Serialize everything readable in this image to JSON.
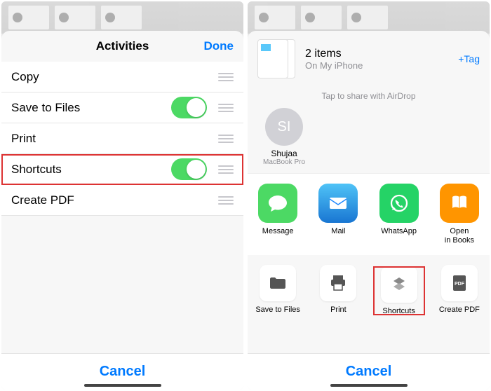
{
  "left": {
    "title": "Activities",
    "done": "Done",
    "rows": [
      {
        "label": "Copy",
        "toggle": false
      },
      {
        "label": "Save to Files",
        "toggle": true
      },
      {
        "label": "Print",
        "toggle": false
      },
      {
        "label": "Shortcuts",
        "toggle": true,
        "highlight": true
      },
      {
        "label": "Create PDF",
        "toggle": false
      }
    ],
    "cancel": "Cancel"
  },
  "right": {
    "items_title": "2 items",
    "items_sub": "On My iPhone",
    "tag": "+Tag",
    "airdrop_hint": "Tap to share with AirDrop",
    "contact": {
      "initials": "SI",
      "name": "Shujaa",
      "device": "MacBook Pro"
    },
    "apps": [
      {
        "name": "Message",
        "color": "#4cd964"
      },
      {
        "name": "Mail",
        "color": "#1e88ff"
      },
      {
        "name": "WhatsApp",
        "color": "#25d366"
      },
      {
        "name": "Open\nin Books",
        "color": "#ff9500"
      }
    ],
    "actions": [
      {
        "name": "Save to Files"
      },
      {
        "name": "Print"
      },
      {
        "name": "Shortcuts",
        "highlight": true
      },
      {
        "name": "Create PDF"
      }
    ],
    "cancel": "Cancel"
  }
}
